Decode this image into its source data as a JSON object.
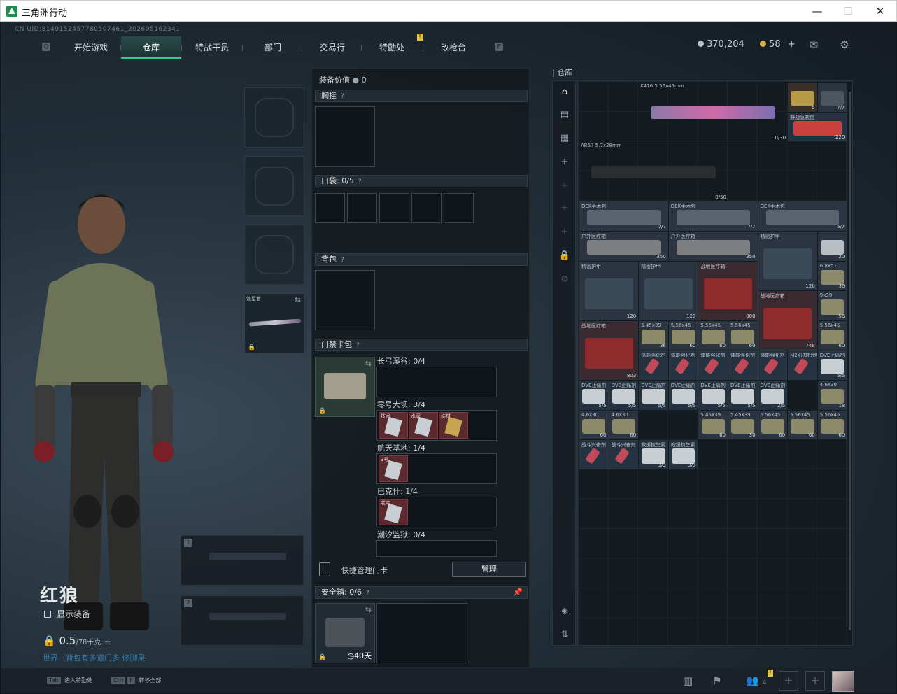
{
  "window": {
    "title": "三角洲行动",
    "min": "—",
    "max": "☐",
    "close": "✕"
  },
  "uid": "CN UID:8149152457780507461_202605162341",
  "nav": {
    "key_left": "Q",
    "key_right": "E",
    "badge": "!",
    "tabs": [
      "开始游戏",
      "仓库",
      "特战干员",
      "部门",
      "交易行",
      "特勤处",
      "改枪台"
    ],
    "active": "仓库"
  },
  "currency": {
    "money": "370,204",
    "coupons": "58",
    "plus": "+",
    "money_color": "#b9c2c9",
    "coupon_color": "#d9b24a"
  },
  "character": {
    "name": "红狼",
    "show_equipment": "显示装备",
    "weight": "0.5",
    "weight_max": "/78千克",
    "hint": "世界（背包有多道门多 修脚果"
  },
  "equip": {
    "weapon_name": "蚀星者",
    "slot1": "1",
    "slot2": "2"
  },
  "mid": {
    "value_label": "装备价值",
    "value": "0",
    "rig_label": "胸挂",
    "pocket_label": "口袋:",
    "pocket_value": "0/5",
    "backpack_label": "背包",
    "keycard_label": "门禁卡包",
    "keycards": [
      {
        "name": "长弓溪谷:",
        "count": "0/4",
        "items": []
      },
      {
        "name": "零号大坝:",
        "count": "3/4",
        "items": [
          "技术",
          "水泥",
          "坊材"
        ]
      },
      {
        "name": "航天基地:",
        "count": "1/4",
        "items": [
          "3号"
        ]
      },
      {
        "name": "巴克什:",
        "count": "1/4",
        "items": [
          "老宅"
        ]
      },
      {
        "name": "潮汐监狱:",
        "count": "0/4",
        "items": []
      }
    ],
    "quick_manage": "快捷管理门卡",
    "manage_btn": "管理",
    "safe_label": "安全箱:",
    "safe_value": "0/6",
    "safe_days": "40天"
  },
  "repo": {
    "title": "仓库",
    "items": [
      {
        "label": "K416 5.56x45mm",
        "count": "0/30",
        "kind": "rifle-pink"
      },
      {
        "label": "",
        "count": "5",
        "kind": "ammo-box"
      },
      {
        "label": "",
        "count": "7/7",
        "kind": "plate"
      },
      {
        "label": "野战急救包",
        "count": "220",
        "kind": "medkit"
      },
      {
        "label": "AR57 5.7x28mm",
        "count": "0/50",
        "kind": "rifle-black"
      },
      {
        "label": "DEK手术包",
        "count": "7/7",
        "kind": "surgery"
      },
      {
        "label": "DEK手术包",
        "count": "7/7",
        "kind": "surgery"
      },
      {
        "label": "DEK手术包",
        "count": "5/7",
        "kind": "surgery"
      },
      {
        "label": "户外医疗箱",
        "count": "350",
        "kind": "outdoor"
      },
      {
        "label": "户外医疗箱",
        "count": "350",
        "kind": "outdoor"
      },
      {
        "label": "精密护甲",
        "count": "120",
        "kind": "armor"
      },
      {
        "label": "",
        "count": "20",
        "kind": "small"
      },
      {
        "label": "精密护甲",
        "count": "120",
        "kind": "armor"
      },
      {
        "label": "精密护甲",
        "count": "120",
        "kind": "armor"
      },
      {
        "label": "战地医疗箱",
        "count": "800",
        "kind": "medbox"
      },
      {
        "label": "战地医疗箱",
        "count": "748",
        "kind": "medbox"
      },
      {
        "label": "6.8x51",
        "count": "36",
        "kind": "ammo"
      },
      {
        "label": "9x39",
        "count": "56",
        "kind": "ammo"
      },
      {
        "label": "战地医疗箱",
        "count": "803",
        "kind": "medbox"
      },
      {
        "label": "5.45x39",
        "count": "36",
        "kind": "ammo"
      },
      {
        "label": "5.56x45",
        "count": "60",
        "kind": "ammo"
      },
      {
        "label": "5.56x45",
        "count": "60",
        "kind": "ammo"
      },
      {
        "label": "5.56x45",
        "count": "60",
        "kind": "ammo"
      },
      {
        "label": "5.56x45",
        "count": "60",
        "kind": "ammo"
      },
      {
        "label": "体能强化剂",
        "count": "",
        "kind": "syringe"
      },
      {
        "label": "体能强化剂",
        "count": "",
        "kind": "syringe"
      },
      {
        "label": "体能强化剂",
        "count": "",
        "kind": "syringe"
      },
      {
        "label": "体能强化剂",
        "count": "",
        "kind": "syringe"
      },
      {
        "label": "体能强化剂",
        "count": "",
        "kind": "syringe"
      },
      {
        "label": "M2肌肉松弛",
        "count": "",
        "kind": "syringe"
      },
      {
        "label": "DVE止痛剂",
        "count": "5/5",
        "kind": "pill"
      },
      {
        "label": "DVE止痛剂",
        "count": "5/5",
        "kind": "pill"
      },
      {
        "label": "DVE止痛剂",
        "count": "5/5",
        "kind": "pill"
      },
      {
        "label": "DVE止痛剂",
        "count": "5/5",
        "kind": "pill"
      },
      {
        "label": "DVE止痛剂",
        "count": "5/5",
        "kind": "pill"
      },
      {
        "label": "DVE止痛剂",
        "count": "5/5",
        "kind": "pill"
      },
      {
        "label": "DVE止痛剂",
        "count": "5/5",
        "kind": "pill"
      },
      {
        "label": "DVE止痛剂",
        "count": "2/5",
        "kind": "pill"
      },
      {
        "label": "4.6x30",
        "count": "60",
        "kind": "ammo"
      },
      {
        "label": "4.6x30",
        "count": "60",
        "kind": "ammo"
      },
      {
        "label": "4.6x30",
        "count": "18",
        "kind": "ammo"
      },
      {
        "label": "5.45x39",
        "count": "60",
        "kind": "ammo"
      },
      {
        "label": "5.45x39",
        "count": "30",
        "kind": "ammo"
      },
      {
        "label": "5.56x45",
        "count": "60",
        "kind": "ammo"
      },
      {
        "label": "5.56x45",
        "count": "60",
        "kind": "ammo"
      },
      {
        "label": "5.56x45",
        "count": "60",
        "kind": "ammo"
      },
      {
        "label": "战斗兴奋剂",
        "count": "",
        "kind": "syringe"
      },
      {
        "label": "战斗兴奋剂",
        "count": "",
        "kind": "syringe"
      },
      {
        "label": "教援抗生素",
        "count": "3/3",
        "kind": "pill"
      },
      {
        "label": "教援抗生素",
        "count": "3/3",
        "kind": "pill"
      }
    ]
  },
  "footer": {
    "tab_key": "Tab",
    "tab_hint": "进入特勤处",
    "ctrl_key": "Ctrl",
    "f_key": "F",
    "ctrl_hint": "转移全部",
    "friends_count": "4",
    "badge": "!"
  }
}
